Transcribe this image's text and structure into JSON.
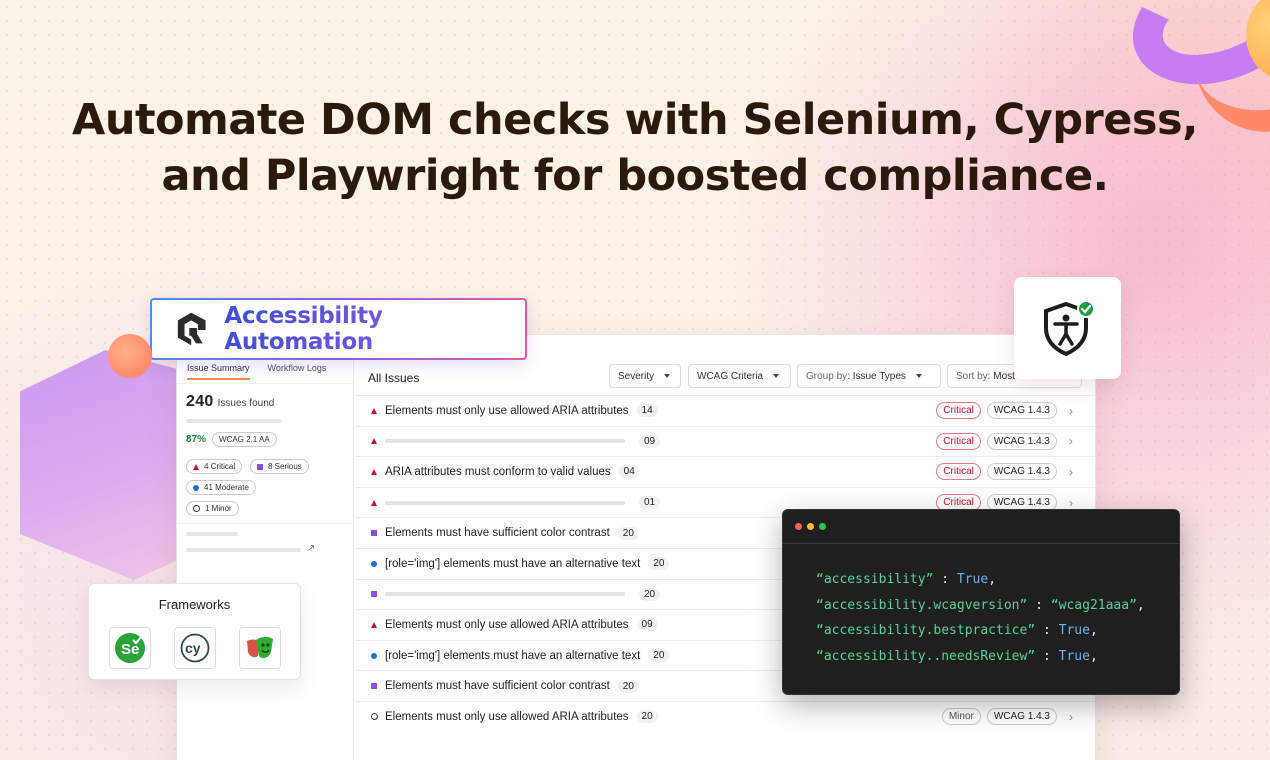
{
  "headline": {
    "line1": "Automate DOM checks with Selenium, Cypress,",
    "line2": "and Playwright for boosted compliance."
  },
  "logo_card": {
    "title": "Accessibility Automation"
  },
  "sidebar": {
    "tabs": [
      "Issue Summary",
      "Workflow Logs"
    ],
    "issues_count": "240",
    "issues_label": "Issues found",
    "percent": "87%",
    "wcag_badge": "WCAG 2.1 AA",
    "severity": {
      "critical": "4 Critical",
      "serious": "8 Serious",
      "moderate": "41 Moderate",
      "minor": "1 Minor"
    }
  },
  "main": {
    "title": "All Issues",
    "filters": {
      "severity": "Severity",
      "wcag": "WCAG Criteria",
      "group_prefix": "Group by:",
      "group_value": "Issue Types",
      "sort_prefix": "Sort by:",
      "sort_value": "Most"
    },
    "rows": [
      {
        "severity": "critical",
        "text": "Elements must only use allowed ARIA attributes",
        "count": "14",
        "badge": "Critical",
        "wcag": "WCAG 1.4.3"
      },
      {
        "severity": "critical",
        "text": "",
        "count": "09",
        "badge": "Critical",
        "wcag": "WCAG 1.4.3"
      },
      {
        "severity": "critical",
        "text": "ARIA attributes must conform to valid values",
        "count": "04",
        "badge": "Critical",
        "wcag": "WCAG 1.4.3"
      },
      {
        "severity": "critical",
        "text": "",
        "count": "01",
        "badge": "Critical",
        "wcag": "WCAG 1.4.3"
      },
      {
        "severity": "serious",
        "text": "Elements must have sufficient color contrast",
        "count": "20"
      },
      {
        "severity": "moderate",
        "text": "[role='img'] elements must have an alternative text",
        "count": "20"
      },
      {
        "severity": "serious",
        "text": "",
        "count": "20"
      },
      {
        "severity": "critical",
        "text": "Elements must only use allowed ARIA attributes",
        "count": "09"
      },
      {
        "severity": "moderate",
        "text": "[role='img'] elements must have an alternative text",
        "count": "20"
      },
      {
        "severity": "serious",
        "text": "Elements must have sufficient color contrast",
        "count": "20"
      },
      {
        "severity": "minor",
        "text": "Elements must only use allowed ARIA attributes",
        "count": "20",
        "badge": "Minor",
        "wcag": "WCAG 1.4.3"
      }
    ]
  },
  "frameworks": {
    "title": "Frameworks",
    "items": [
      "selenium-logo",
      "cypress-logo",
      "playwright-logo"
    ],
    "selenium_text": "Se",
    "cypress_text": "cy"
  },
  "code": {
    "lines": [
      {
        "key": "“accessibility”",
        "sep": " : ",
        "value": "True",
        "end": ","
      },
      {
        "key": "“accessibility.wcagversion”",
        "sep": " : ",
        "value": "“wcag21aaa”",
        "end": ","
      },
      {
        "key": "“accessibility.bestpractice”",
        "sep": " : ",
        "value": "True",
        "end": ","
      },
      {
        "key": "“accessibility..needsReview”",
        "sep": " : ",
        "value": "True",
        "end": ","
      }
    ]
  },
  "colors": {
    "critical": "#c8102e",
    "serious": "#8a4fe0",
    "moderate": "#1e6fd9",
    "pass": "#1c8a3a",
    "code_key": "#57d39b",
    "code_value": "#6bb3f2"
  }
}
